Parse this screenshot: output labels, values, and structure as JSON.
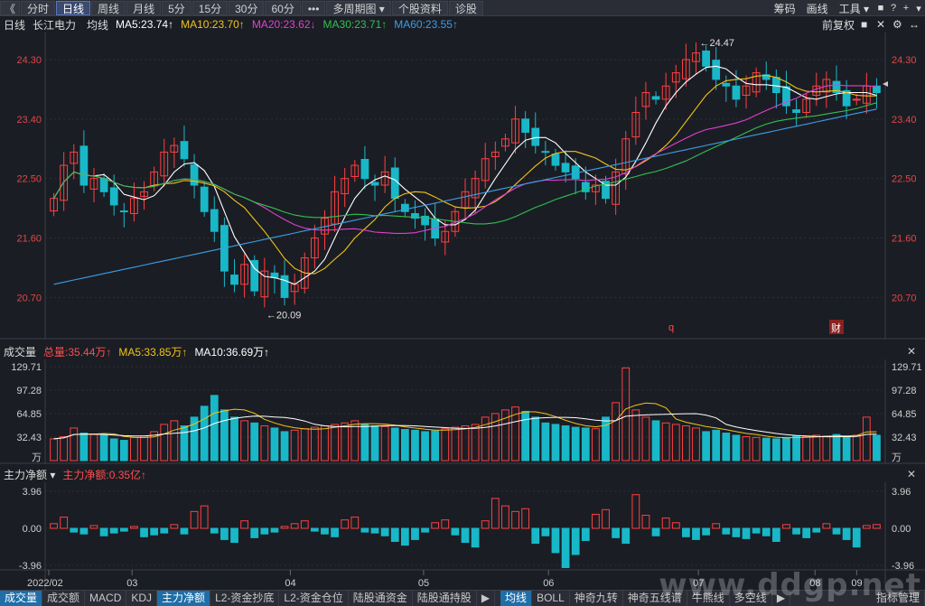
{
  "toolbar": {
    "back": "《",
    "tabs": [
      "分时",
      "日线",
      "周线",
      "月线",
      "5分",
      "15分",
      "30分",
      "60分",
      "•••",
      "多周期图 ▾",
      "个股资料",
      "诊股"
    ],
    "active_index": 1,
    "right_links": [
      "筹码",
      "画线",
      "工具 ▾"
    ],
    "right_icons": [
      "lock-icon",
      "help-icon",
      "plus-icon",
      "chevron-down-icon"
    ]
  },
  "ma_header": {
    "period": "日线",
    "name": "长江电力",
    "avg_label": "均线",
    "ma5": "MA5:23.74↑",
    "ma10": "MA10:23.70↑",
    "ma20": "MA20:23.62↓",
    "ma30": "MA30:23.71↑",
    "ma60": "MA60:23.55↑",
    "adjust": "前复权",
    "colors": {
      "ma5": "#ffffff",
      "ma10": "#f0c419",
      "ma20": "#e040d0",
      "ma30": "#30c050",
      "ma60": "#3a9ee8"
    }
  },
  "volume_header": {
    "title": "成交量",
    "total": "总量:35.44万↑",
    "ma5": "MA5:33.85万↑",
    "ma10": "MA10:36.69万↑"
  },
  "flow_header": {
    "title": "主力净额 ▾",
    "value": "主力净额:0.35亿↑"
  },
  "bottom_tabs_left": [
    "成交量",
    "成交额",
    "MACD",
    "KDJ",
    "主力净额",
    "L2-资金抄底",
    "L2-资金仓位",
    "陆股通资金",
    "陆股通持股"
  ],
  "bottom_tabs_right": [
    "均线",
    "BOLL",
    "神奇九转",
    "神奇五线谱",
    "牛熊线",
    "多空线"
  ],
  "bottom_active_left": [
    0,
    4
  ],
  "bottom_active_right": 0,
  "bottom_extra": "指标管理",
  "watermark": "www.ddgp.net",
  "chart_data": {
    "type": "candlestick",
    "price_ticks": [
      "24.30",
      "23.40",
      "22.50",
      "21.60",
      "20.70"
    ],
    "price_range": [
      20.2,
      24.6
    ],
    "high_label": "24.47",
    "low_label": "20.09",
    "markers": [
      "q",
      "财"
    ],
    "volume_ticks": [
      "129.71",
      "97.28",
      "64.85",
      "32.43",
      "万"
    ],
    "volume_range": [
      0,
      129.71
    ],
    "flow_ticks": [
      "3.96",
      "0.00",
      "-3.96"
    ],
    "flow_range": [
      -3.96,
      3.96
    ],
    "x_labels": [
      "2022/02",
      "03",
      "04",
      "05",
      "06",
      "07",
      "08",
      "09"
    ],
    "close": [
      22.2,
      22.7,
      22.9,
      22.4,
      22.5,
      22.3,
      22.1,
      22.0,
      22.2,
      22.3,
      22.6,
      22.9,
      23.0,
      22.8,
      22.4,
      22.0,
      21.7,
      21.1,
      20.9,
      21.2,
      20.8,
      21.1,
      21.0,
      20.7,
      20.9,
      21.3,
      21.6,
      21.9,
      22.3,
      22.5,
      22.7,
      22.5,
      22.4,
      22.6,
      22.2,
      22.0,
      21.9,
      21.8,
      21.6,
      21.7,
      22.0,
      22.3,
      22.5,
      22.8,
      22.9,
      23.1,
      23.4,
      23.2,
      23.0,
      22.9,
      22.7,
      22.6,
      22.5,
      22.3,
      22.4,
      22.2,
      22.6,
      23.1,
      23.5,
      23.8,
      23.7,
      23.9,
      24.1,
      24.3,
      24.4,
      24.2,
      24.0,
      23.9,
      23.7,
      23.9,
      24.1,
      24.0,
      23.8,
      23.6,
      23.5,
      23.7,
      23.9,
      24.0,
      23.8,
      23.6,
      23.7,
      23.9,
      23.8
    ],
    "volume": [
      30,
      33,
      45,
      38,
      36,
      35,
      30,
      28,
      32,
      34,
      40,
      50,
      55,
      48,
      60,
      75,
      90,
      70,
      60,
      55,
      52,
      48,
      45,
      40,
      42,
      44,
      46,
      48,
      50,
      52,
      55,
      50,
      48,
      47,
      45,
      43,
      42,
      40,
      41,
      44,
      46,
      48,
      50,
      60,
      65,
      70,
      74,
      68,
      60,
      52,
      50,
      48,
      46,
      45,
      44,
      60,
      80,
      128,
      70,
      60,
      55,
      52,
      50,
      48,
      45,
      40,
      42,
      38,
      35,
      33,
      32,
      31,
      30,
      32,
      34,
      33,
      35,
      34,
      36,
      33,
      35,
      60,
      35
    ],
    "flow": [
      0.5,
      1.2,
      -0.4,
      -0.6,
      0.3,
      -0.8,
      -0.5,
      -0.3,
      0.2,
      -0.9,
      -0.7,
      -0.5,
      0.4,
      -0.6,
      1.8,
      2.4,
      -0.5,
      -1.2,
      -1.5,
      0.8,
      -1.0,
      -0.6,
      -0.4,
      0.2,
      0.5,
      0.8,
      -0.3,
      -0.6,
      -0.9,
      0.9,
      1.2,
      -0.4,
      -0.5,
      -0.8,
      -1.4,
      -1.8,
      -1.2,
      -0.4,
      0.6,
      0.9,
      -0.7,
      -1.5,
      -2.0,
      0.8,
      3.2,
      2.4,
      1.8,
      2.1,
      -1.6,
      -0.8,
      -2.6,
      -4.2,
      -2.8,
      -1.3,
      1.5,
      2.0,
      -1.0,
      -1.6,
      3.6,
      1.4,
      -0.8,
      1.1,
      0.6,
      -0.9,
      -1.2,
      -0.7,
      0.5,
      -0.6,
      -0.9,
      -1.1,
      -0.5,
      -0.8,
      -1.4,
      0.4,
      -0.6,
      -1.0,
      -0.4,
      0.5,
      -0.6,
      -1.2,
      -2.0,
      0.3,
      0.4
    ]
  }
}
